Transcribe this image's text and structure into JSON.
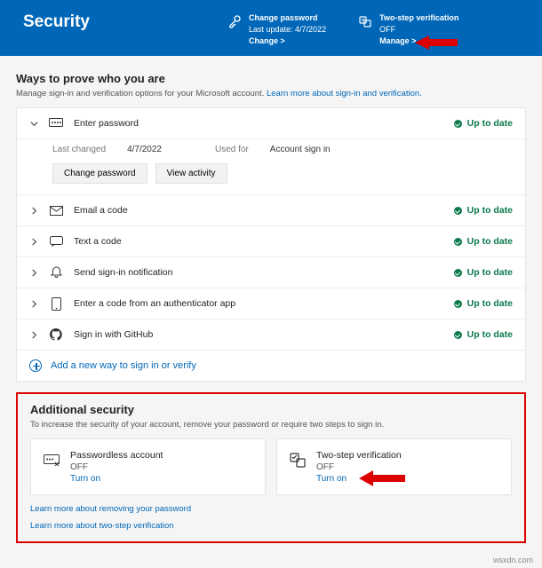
{
  "header": {
    "title": "Security",
    "changePassword": {
      "title": "Change password",
      "lastUpdate": "Last update: 4/7/2022",
      "action": "Change",
      "chevron": ">"
    },
    "twoStep": {
      "title": "Two-step verification",
      "status": "OFF",
      "action": "Manage",
      "chevron": ">"
    }
  },
  "prove": {
    "title": "Ways to prove who you are",
    "subPrefix": "Manage sign-in and verification options for your Microsoft account. ",
    "subLink": "Learn more about sign-in and verification.",
    "items": [
      {
        "label": "Enter password",
        "status": "Up to date"
      },
      {
        "label": "Email a code",
        "status": "Up to date"
      },
      {
        "label": "Text a code",
        "status": "Up to date"
      },
      {
        "label": "Send sign-in notification",
        "status": "Up to date"
      },
      {
        "label": "Enter a code from an authenticator app",
        "status": "Up to date"
      },
      {
        "label": "Sign in with GitHub",
        "status": "Up to date"
      }
    ],
    "expanded": {
      "lastChangedLabel": "Last changed",
      "lastChanged": "4/7/2022",
      "usedForLabel": "Used for",
      "usedFor": "Account sign in",
      "btnChange": "Change password",
      "btnActivity": "View activity"
    },
    "addNew": "Add a new way to sign in or verify"
  },
  "additional": {
    "title": "Additional security",
    "sub": "To increase the security of your account, remove your password or require two steps to sign in.",
    "tiles": [
      {
        "title": "Passwordless account",
        "status": "OFF",
        "action": "Turn on"
      },
      {
        "title": "Two-step verification",
        "status": "OFF",
        "action": "Turn on"
      }
    ],
    "learn1": "Learn more about removing your password",
    "learn2": "Learn more about two-step verification"
  },
  "footer": "wsxdn.com"
}
